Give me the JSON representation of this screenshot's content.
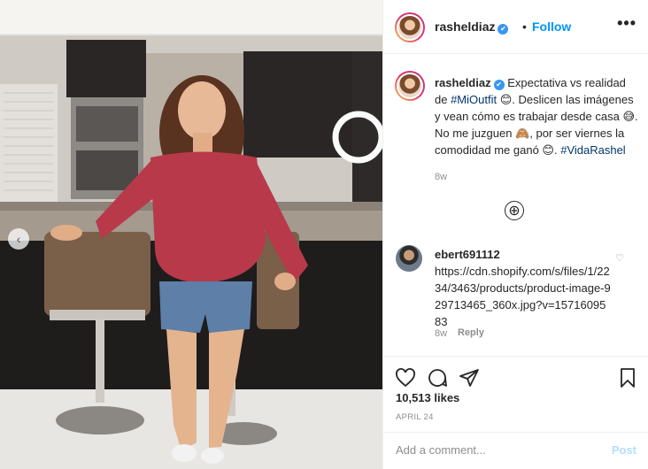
{
  "post": {
    "username": "rasheldiaz",
    "follow_label": "Follow",
    "separator": "•",
    "more_label": "•••",
    "verified_mark": "✔"
  },
  "caption": {
    "username": "rasheldiaz",
    "text_1": "Expectativa vs realidad de ",
    "tag_1": "#MiOutfit",
    "emoji_1": "😊",
    "text_2": ". Deslicen las imágenes y vean cómo es trabajar desde casa ",
    "emoji_2": "😅",
    "text_3": ". No me juzguen ",
    "emoji_3": "🙈",
    "text_4": ", por ser viernes la comodidad me ganó ",
    "emoji_4": "😊",
    "text_5": ". ",
    "tag_2": "#VidaRashel",
    "time": "8w"
  },
  "load_more_icon": "⊕",
  "comments": [
    {
      "username": "ebert691112",
      "text": "https://cdn.shopify.com/s/files/1/2234/3463/products/product-image-929713465_360x.jpg?v=1571609583",
      "time": "8w",
      "reply_label": "Reply",
      "like_icon": "♡"
    }
  ],
  "actions": {
    "like_icon": "heart-icon",
    "comment_icon": "comment-icon",
    "share_icon": "share-icon",
    "save_icon": "bookmark-icon"
  },
  "likes": "10,513 likes",
  "date": "APRIL 24",
  "add_comment": {
    "placeholder": "Add a comment...",
    "post_label": "Post"
  },
  "carousel": {
    "prev_icon": "‹"
  },
  "colors": {
    "accent": "#0095f6",
    "post_disabled": "#b2dffc",
    "muted": "#8e8e8e"
  }
}
